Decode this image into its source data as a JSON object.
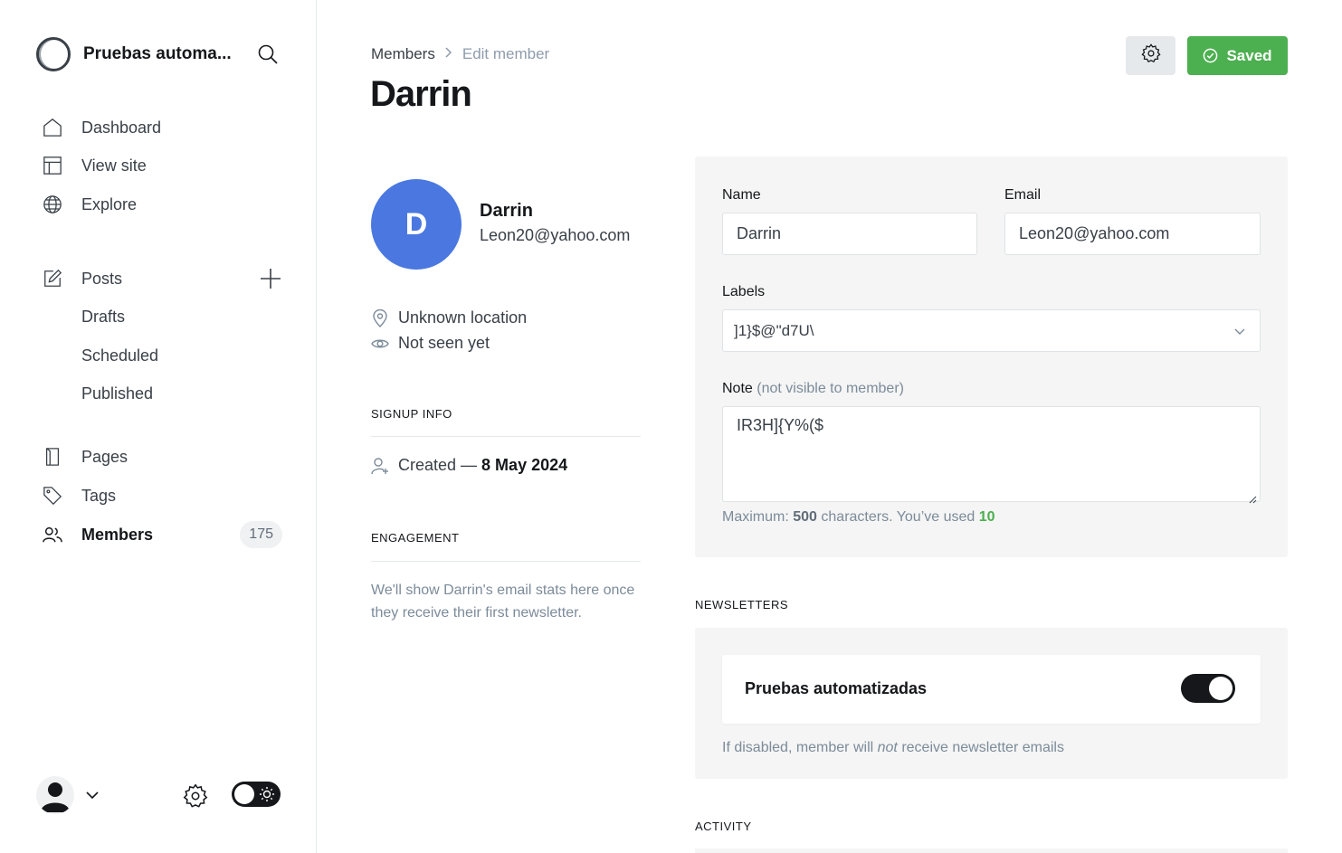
{
  "sidebar": {
    "site_name": "Pruebas automa...",
    "nav": {
      "dashboard": "Dashboard",
      "view_site": "View site",
      "explore": "Explore",
      "posts": "Posts",
      "drafts": "Drafts",
      "scheduled": "Scheduled",
      "published": "Published",
      "pages": "Pages",
      "tags": "Tags",
      "members": "Members",
      "members_count": "175"
    },
    "icons": {
      "search": "search-icon",
      "dashboard": "home-icon",
      "view_site": "layout-icon",
      "explore": "globe-icon",
      "posts": "edit-icon",
      "add_post": "plus-icon",
      "pages": "book-icon",
      "tags": "tag-icon",
      "members": "users-icon",
      "settings": "gear-icon",
      "theme": "sun-icon"
    }
  },
  "header": {
    "breadcrumb_parent": "Members",
    "breadcrumb_current": "Edit member",
    "title": "Darrin",
    "saved_label": "Saved",
    "accent_color": "#4caf50"
  },
  "member": {
    "initial": "D",
    "name": "Darrin",
    "email": "Leon20@yahoo.com",
    "location": "Unknown location",
    "seen": "Not seen yet",
    "avatar_color": "#4a78e0"
  },
  "signup": {
    "heading": "SIGNUP INFO",
    "created_prefix": "Created —",
    "created_date": "8 May 2024"
  },
  "engagement": {
    "heading": "ENGAGEMENT",
    "text": "We'll show Darrin's email stats here once they receive their first newsletter."
  },
  "form": {
    "name_label": "Name",
    "name_value": "Darrin",
    "email_label": "Email",
    "email_value": "Leon20@yahoo.com",
    "labels_label": "Labels",
    "labels_value": "]1}$@\"d7U\\",
    "note_label": "Note",
    "note_muted": "(not visible to member)",
    "note_value": "IR3H]{Y%($",
    "hint_prefix": "Maximum:",
    "hint_max": "500",
    "hint_middle": "characters. You’ve used",
    "hint_used": "10"
  },
  "newsletters": {
    "heading": "NEWSLETTERS",
    "name": "Pruebas automatizadas",
    "subscribed": true,
    "hint_before": "If disabled, member will",
    "hint_em": "not",
    "hint_after": "receive newsletter emails"
  },
  "activity": {
    "heading": "ACTIVITY"
  }
}
